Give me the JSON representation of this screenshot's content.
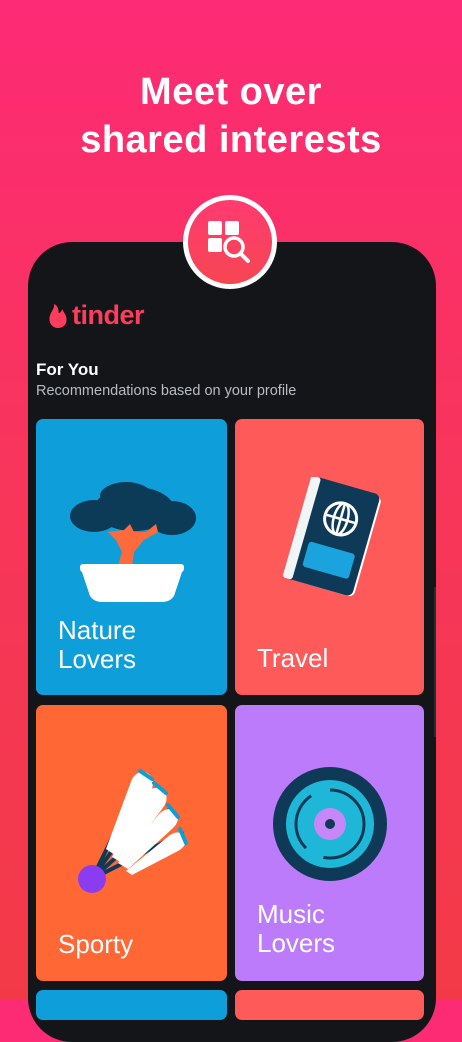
{
  "headline": {
    "line1": "Meet over",
    "line2": "shared interests"
  },
  "app": {
    "logo_text": "tinder"
  },
  "section": {
    "title": "For You",
    "subtitle": "Recommendations based on your profile"
  },
  "cards": [
    {
      "label": "Nature\nLovers",
      "color": "#0e9fda",
      "icon": "bonsai-icon"
    },
    {
      "label": "Travel",
      "color": "#ff5a5a",
      "icon": "passport-icon"
    },
    {
      "label": "Sporty",
      "color": "#ff6734",
      "icon": "shuttlecock-icon"
    },
    {
      "label": "Music\nLovers",
      "color": "#bc7bfa",
      "icon": "vinyl-record-icon"
    }
  ],
  "colors": {
    "background_top": "#fd2a75",
    "background_bottom": "#f23a47",
    "phone": "#131518",
    "brand": "#fe3c5b"
  },
  "badge": {
    "icon": "explore-search-icon"
  }
}
